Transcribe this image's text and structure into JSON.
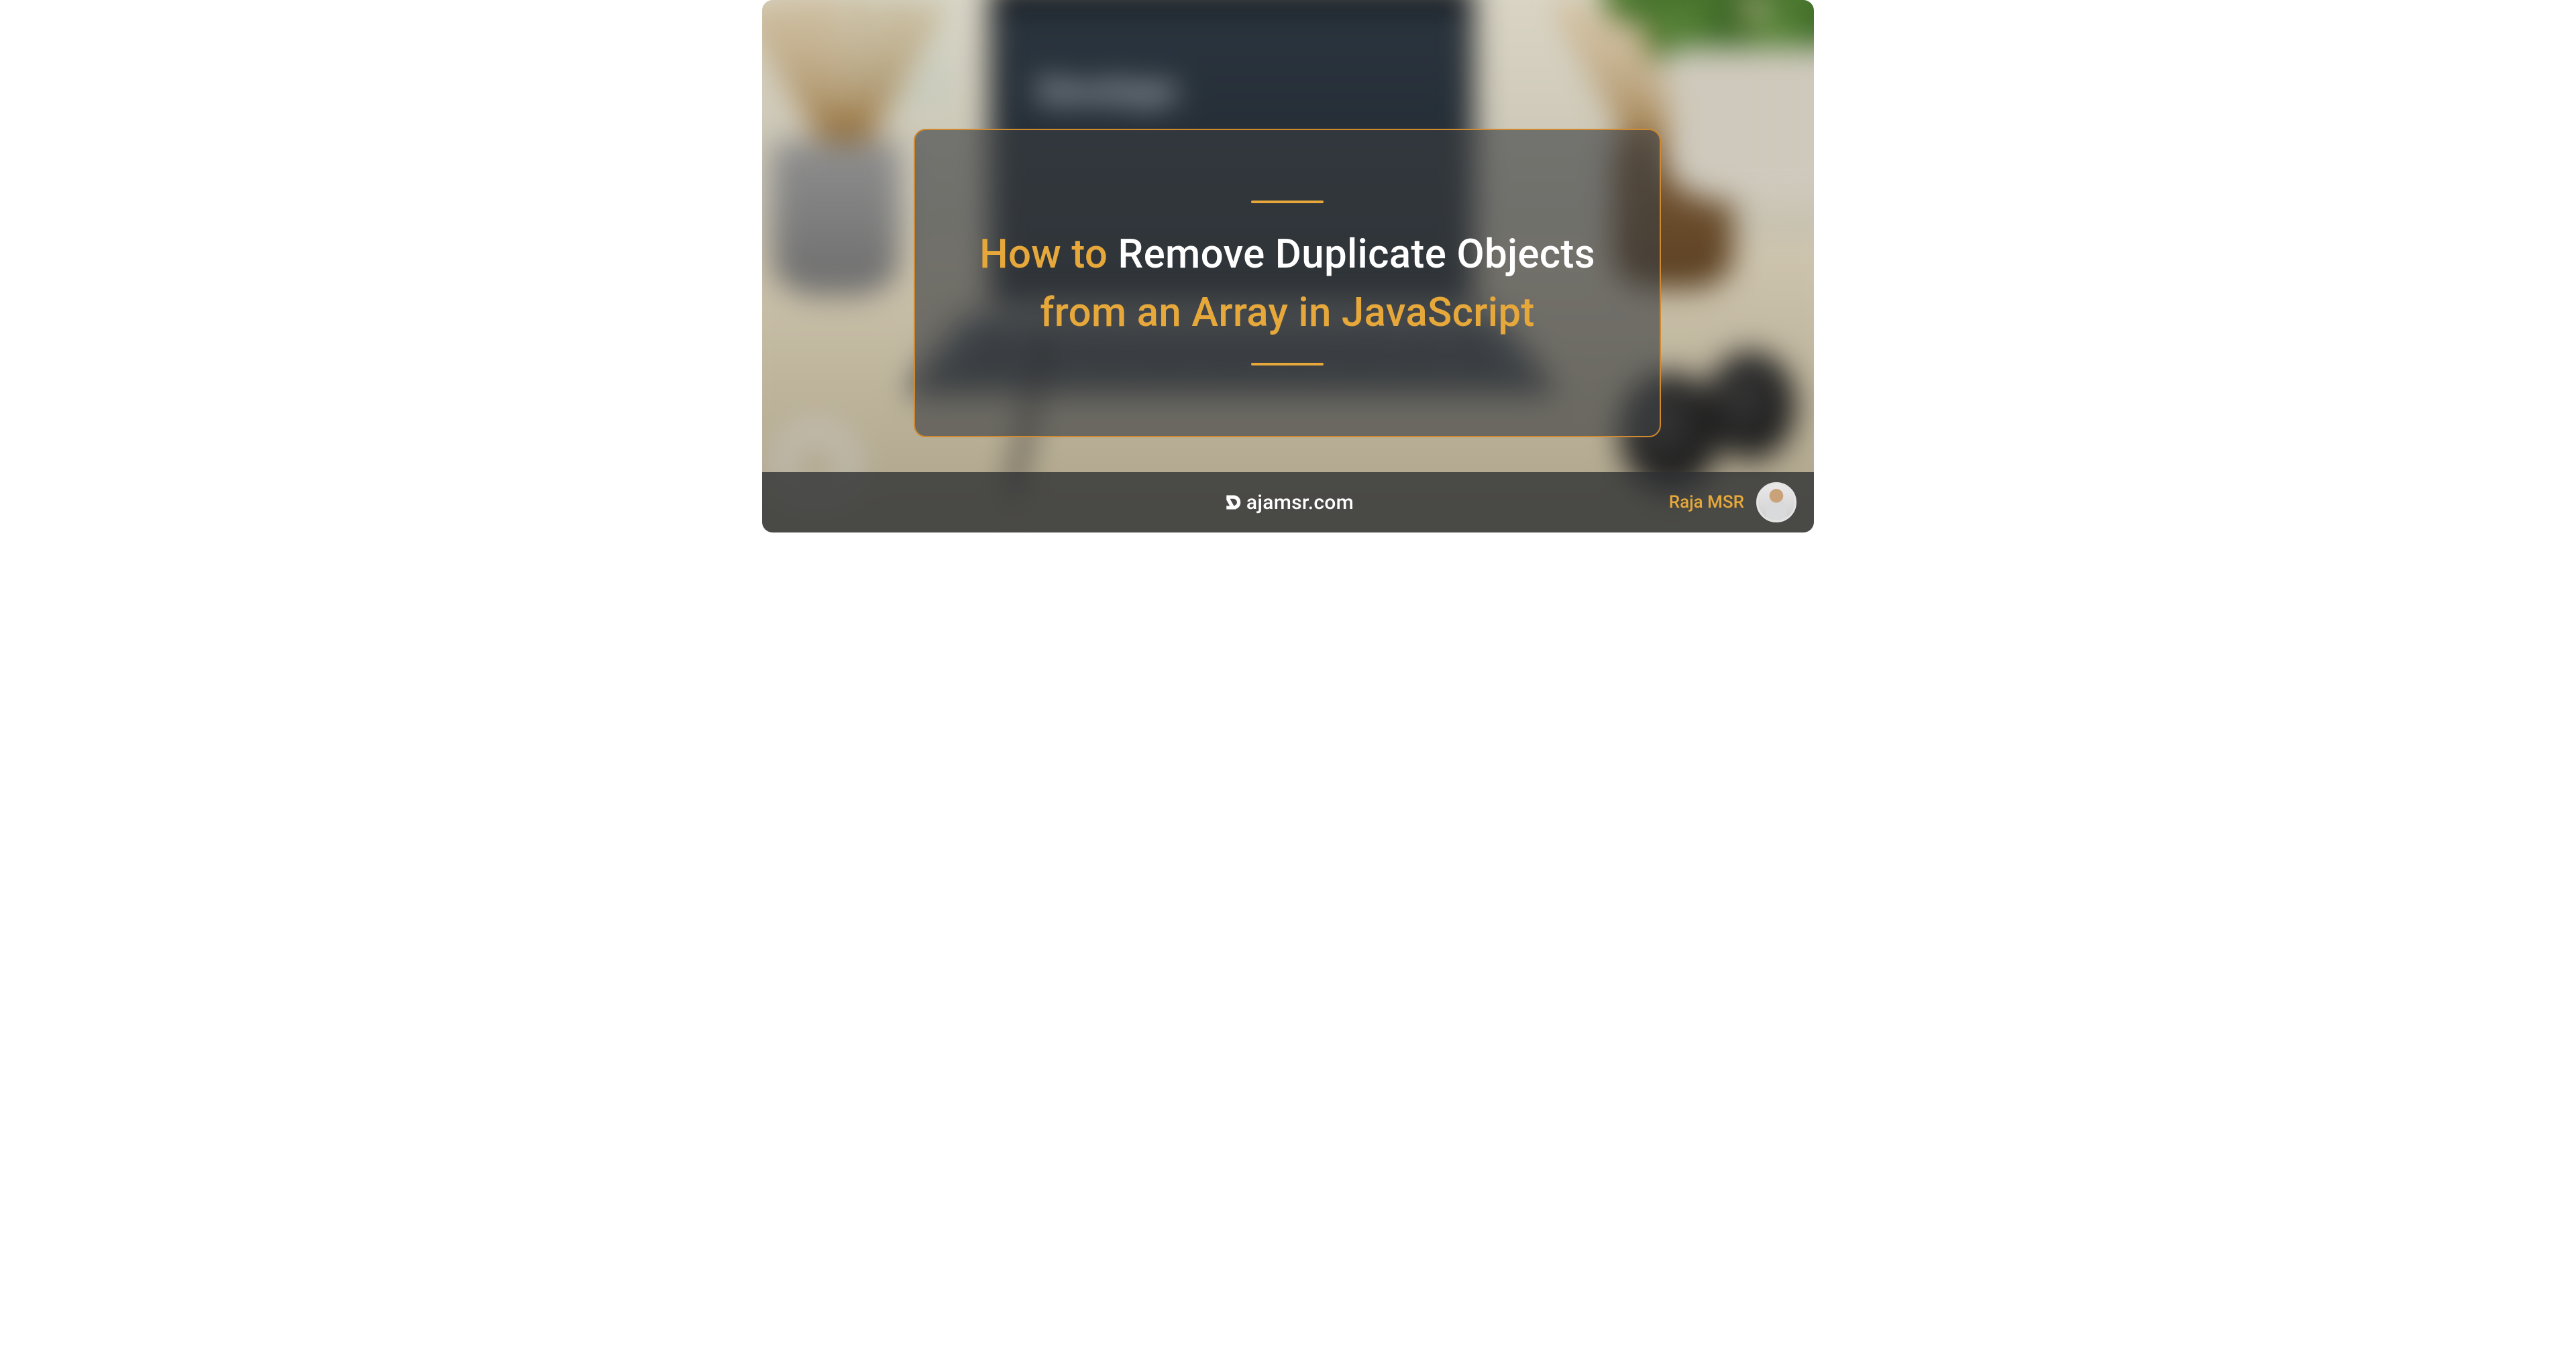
{
  "title": {
    "segments": [
      {
        "text": "How to ",
        "style": "hl"
      },
      {
        "text": "Remove Duplicate Objects ",
        "style": "plain"
      },
      {
        "text": "from an Array in JavaScript",
        "style": "hl"
      }
    ],
    "seg0": "How to ",
    "seg1": "Remove Duplicate Objects ",
    "seg2": "from an Array in JavaScript"
  },
  "background": {
    "laptop_screen_text": "Devslope"
  },
  "footer": {
    "brand_text": "ajamsr.com",
    "author_name": "Raja MSR"
  },
  "colors": {
    "accent": "#e6a83b",
    "card_border": "#d18a2f",
    "text_white": "#ffffff"
  }
}
